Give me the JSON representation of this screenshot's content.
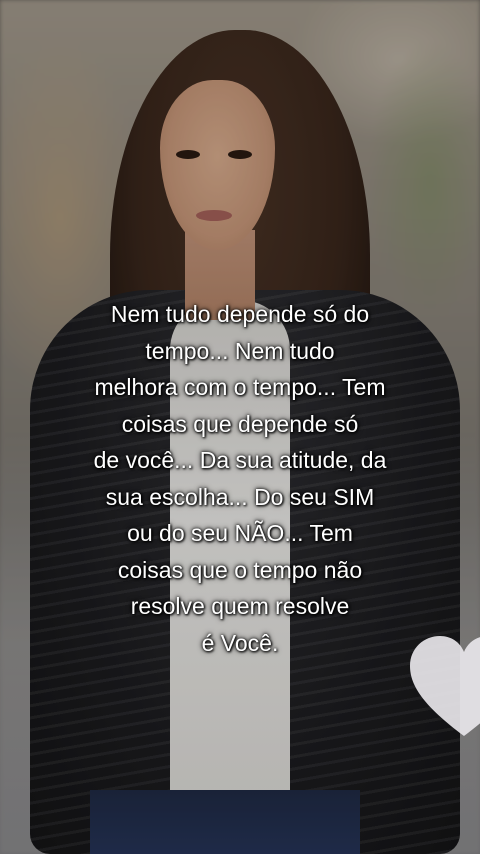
{
  "caption": {
    "lines": [
      "Nem tudo depende só do",
      "tempo... Nem tudo",
      "melhora com o tempo... Tem",
      "coisas que depende só",
      "de você... Da sua atitude, da",
      "sua escolha... Do seu SIM",
      "ou do seu NÃO... Tem",
      "coisas que o tempo não",
      "resolve quem resolve",
      "é Você."
    ],
    "color": "#ffffff"
  },
  "decoration": {
    "heart_icon": "heart-icon",
    "heart_color": "#e8e6ea"
  }
}
